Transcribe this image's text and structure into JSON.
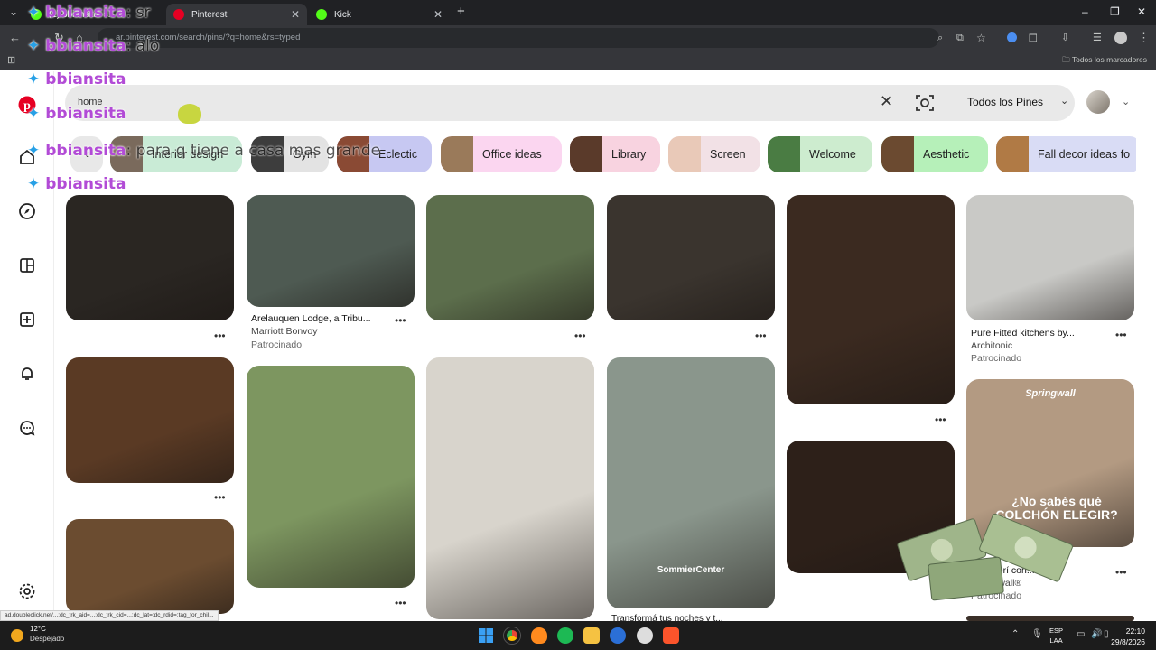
{
  "browser": {
    "tabs": [
      {
        "title": "(1) bbiansita: s...",
        "active": false
      },
      {
        "title": "Pinterest",
        "active": true
      },
      {
        "title": "Kick",
        "active": false
      }
    ],
    "new_tab": "+",
    "url": "ar.pinterest.com/search/pins/?q=home&rs=typed",
    "bookmarks_label": "Todos los marcadores"
  },
  "search": {
    "query": "home",
    "filter_label": "Todos los Pines"
  },
  "chips": [
    {
      "label": "Interior design",
      "bg": "#c9ebd6",
      "thumb": "#7a6a5c"
    },
    {
      "label": "Gym",
      "bg": "#e3e3e3",
      "thumb": "#3d3d3d"
    },
    {
      "label": "Eclectic",
      "bg": "#c7c8f2",
      "thumb": "#8a4a34"
    },
    {
      "label": "Office ideas",
      "bg": "#fbd6f0",
      "thumb": "#9a7a5a"
    },
    {
      "label": "Library",
      "bg": "#f8d3e0",
      "thumb": "#5a3a2a"
    },
    {
      "label": "Screen",
      "bg": "#f2e1e6",
      "thumb": "#e9c9b8"
    },
    {
      "label": "Welcome",
      "bg": "#cdeccf",
      "thumb": "#4a7c43"
    },
    {
      "label": "Aesthetic",
      "bg": "#b6f0b9",
      "thumb": "#6b4a30"
    },
    {
      "label": "Fall decor ideas fo",
      "bg": "#d9dcf5",
      "thumb": "#b07a45"
    }
  ],
  "pins": [
    {
      "name": "pin-dark-living-room",
      "bg": "#2a2622"
    },
    {
      "name": "pin-lodge",
      "bg": "#4e5a52",
      "title": "Arelauquen Lodge, a Tribu...",
      "sub": "Marriott Bonvoy",
      "sponsored": "Patrocinado"
    },
    {
      "name": "pin-blue-house",
      "bg": "#5c6e4c"
    },
    {
      "name": "pin-cozy-lounge",
      "bg": "#3a342e"
    },
    {
      "name": "pin-warm-dining",
      "bg": "#3b2a20"
    },
    {
      "name": "pin-white-kitchen",
      "bg": "#c9c9c6",
      "title": "Pure Fitted kitchens by...",
      "sub": "Architonic",
      "sponsored": "Patrocinado"
    },
    {
      "name": "pin-stair-hall",
      "bg": "#5a3a24"
    },
    {
      "name": "pin-farmhouse",
      "bg": "#7d9660"
    },
    {
      "name": "pin-white-kitchen-2",
      "bg": "#d8d4cc"
    },
    {
      "name": "pin-mattress-ad",
      "bg": "#8a968c",
      "brand": "SommierCenter",
      "title": "Transformá tus noches y t..."
    },
    {
      "name": "pin-night-room",
      "bg": "#2d2019"
    },
    {
      "name": "pin-springwall-ad",
      "bg": "#b39a82",
      "brand": "Springwall",
      "headline": "¿No sabés qué COLCHÓN ELEGIR?",
      "title": "Descubrí con...",
      "sub": "Springwall®",
      "sponsored": "Patrocinado"
    },
    {
      "name": "pin-ceiling-lights",
      "bg": "#6b4c30"
    }
  ],
  "more_glyph": "•••",
  "chat": [
    {
      "user": "bbiansita",
      "msg": ": sr"
    },
    {
      "user": "bbiansita",
      "msg": ": alo"
    },
    {
      "user": "bbiansita",
      "msg": ""
    },
    {
      "user": "bbiansita",
      "msg": ""
    },
    {
      "user": "bbiansita",
      "msg": ": para q tiene a casa mas grande"
    },
    {
      "user": "bbiansita",
      "msg": ""
    }
  ],
  "status_url": "ad.doubleclick.net/...;dc_trk_aid=...;dc_trk_cid=...;dc_lat=;dc_rdid=;tag_for_chil...",
  "taskbar": {
    "temp": "12°C",
    "weather": "Despejado",
    "lang_1": "ESP",
    "lang_2": "LAA",
    "time": "22:10",
    "date": "29/8/2026"
  },
  "colors": {
    "pinterest_red": "#e60023",
    "chat_user": "#b24bd6",
    "chat_star": "#27a0e6"
  }
}
